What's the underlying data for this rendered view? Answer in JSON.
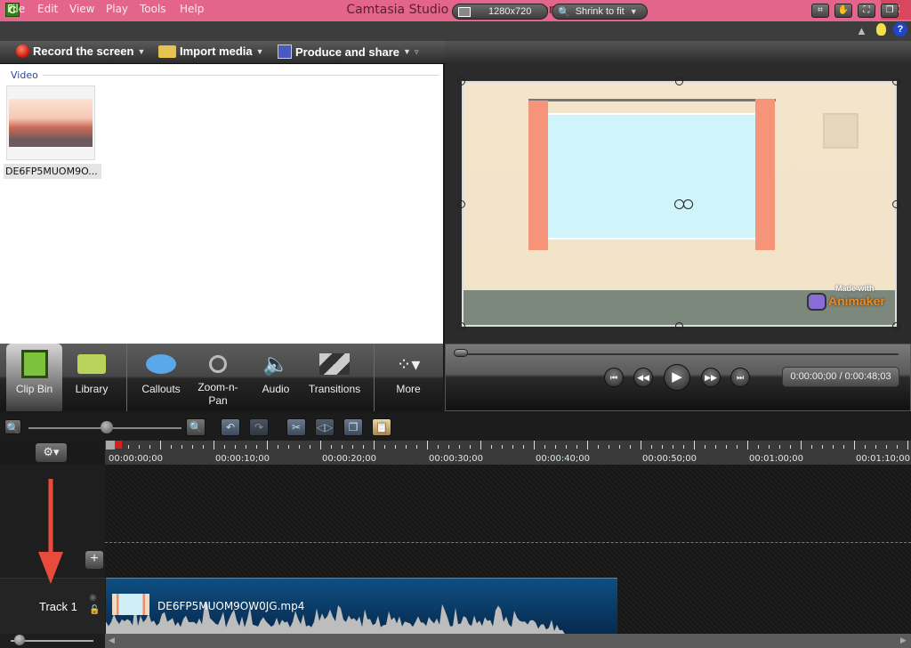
{
  "window": {
    "title": "Camtasia Studio - Untitled.camproj",
    "app_icon": "C",
    "minimize": "–",
    "restore": "❐",
    "close": "✕"
  },
  "menu": [
    "File",
    "Edit",
    "View",
    "Play",
    "Tools",
    "Help"
  ],
  "notify": {
    "bell": "🔔",
    "tip": "💡",
    "help": "?"
  },
  "toolbar": {
    "record": "Record the screen",
    "import": "Import media",
    "produce": "Produce and share"
  },
  "clipbin": {
    "section": "Video",
    "clip_label": "DE6FP5MUOM9O..."
  },
  "tabs": [
    {
      "label": "Clip Bin",
      "icon": "film-icon"
    },
    {
      "label": "Library",
      "icon": "folder-icon"
    },
    {
      "label": "Callouts",
      "icon": "speech-bubble-icon"
    },
    {
      "label": "Zoom-n-Pan",
      "icon": "magnifier-icon"
    },
    {
      "label": "Audio",
      "icon": "speaker-icon"
    },
    {
      "label": "Transitions",
      "icon": "transition-icon"
    },
    {
      "label": "More",
      "icon": "more-icon"
    }
  ],
  "preview": {
    "dimensions": "1280x720",
    "zoom": "Shrink to fit",
    "watermark_top": "Made with",
    "watermark_brand": "Animaker"
  },
  "player": {
    "timecode": "0:00:00;00 / 0:00:48;03",
    "progress": 0
  },
  "timeline": {
    "ticks": [
      "00:00:00;00",
      "00:00:10;00",
      "00:00:20;00",
      "00:00:30;00",
      "00:00:40;00",
      "00:00:50;00",
      "00:01:00;00",
      "00:01:10;00"
    ],
    "track_name": "Track 1",
    "clip_name": "DE6FP5MUOM9OW0JG.mp4"
  }
}
